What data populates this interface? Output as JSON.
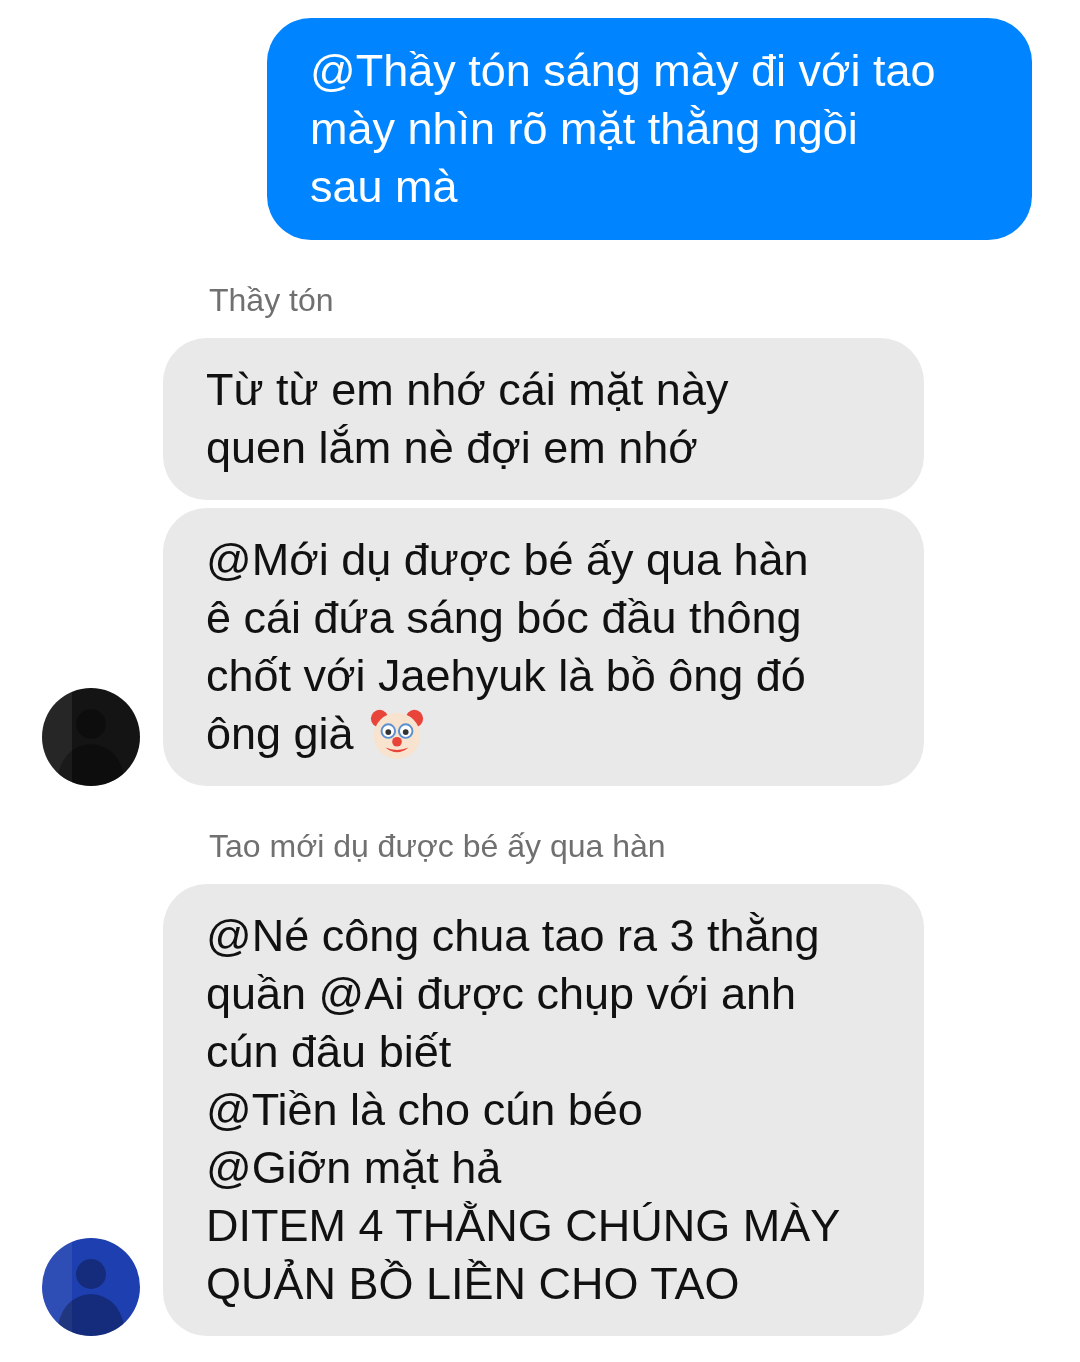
{
  "messages": [
    {
      "kind": "sent",
      "text": "@Thầy tón sáng mày đi với tao\nmày nhìn rõ mặt thằng ngồi\nsau mà"
    },
    {
      "kind": "received_group",
      "sender": "Thầy tón",
      "avatar": {
        "kind": "picture",
        "color": "#141414"
      },
      "bubbles": [
        {
          "kind": "text",
          "text": "Từ từ em nhớ cái mặt này\nquen lắm nè đợi em nhớ"
        },
        {
          "kind": "text_with_clown",
          "text": "@Mới dụ được bé ấy qua hàn\nê cái đứa sáng bóc đầu thông\nchốt với Jaehyuk là bồ ông đó",
          "text_end": "ông già"
        }
      ]
    },
    {
      "kind": "received_group",
      "sender": "Tao mới dụ được bé ấy qua hàn",
      "avatar": {
        "kind": "picture",
        "color": "#1d3fb0"
      },
      "bubbles": [
        {
          "kind": "text",
          "text": "@Né công chua tao ra 3 thằng\nquần @Ai được chụp với anh\ncún đâu biết\n@Tiền là cho cún béo\n@Giỡn mặt hả\nDITEM 4 THẰNG CHÚNG MÀY\nQUẢN BỒ LIỀN CHO TAO"
        }
      ]
    }
  ]
}
